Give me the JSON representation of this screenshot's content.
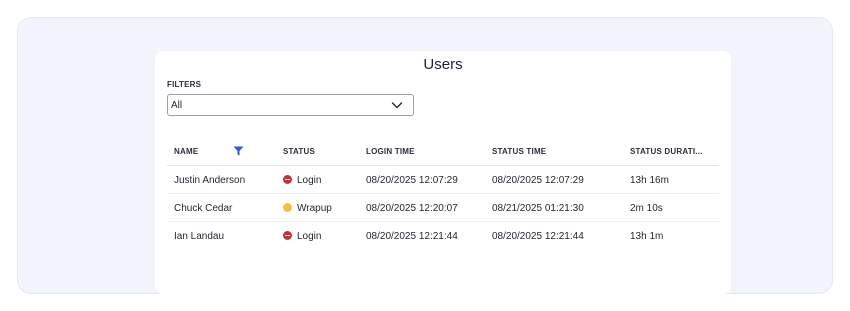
{
  "page": {
    "title": "Users"
  },
  "filters": {
    "label": "FILTERS",
    "selected": "All",
    "chevron_icon": "chevron-down-icon"
  },
  "table": {
    "columns": [
      "NAME",
      "STATUS",
      "LOGIN TIME",
      "STATUS TIME",
      "STATUS DURATI..."
    ],
    "filter_icon": "filter-funnel-icon",
    "filter_icon_color": "#2f5bd8",
    "rows": [
      {
        "name": "Justin Anderson",
        "status": "Login",
        "status_icon": "status-busy-icon",
        "status_color": "#c62f36",
        "login_time": "08/20/2025 12:07:29",
        "status_time": "08/20/2025 12:07:29",
        "duration": "13h 16m"
      },
      {
        "name": "Chuck Cedar",
        "status": "Wrapup",
        "status_icon": "status-away-icon",
        "status_color": "#f2bf44",
        "login_time": "08/20/2025 12:20:07",
        "status_time": "08/21/2025 01:21:30",
        "duration": "2m 10s"
      },
      {
        "name": "Ian Landau",
        "status": "Login",
        "status_icon": "status-busy-icon",
        "status_color": "#c62f36",
        "login_time": "08/20/2025 12:21:44",
        "status_time": "08/20/2025 12:21:44",
        "duration": "13h 1m"
      }
    ]
  }
}
